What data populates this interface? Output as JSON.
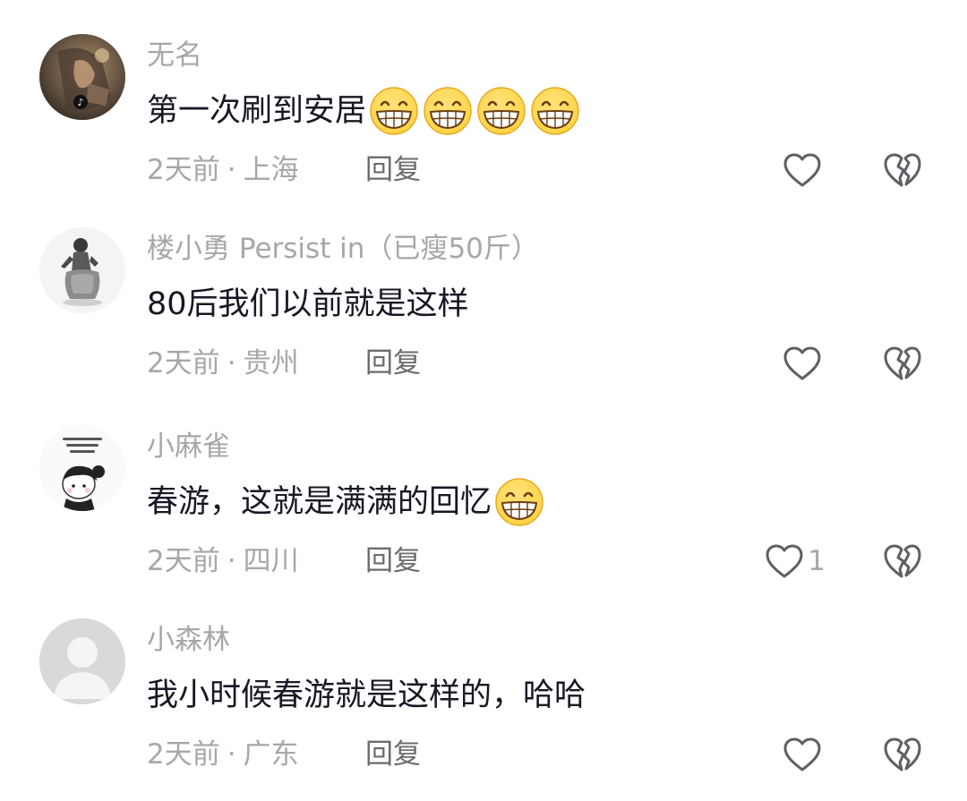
{
  "comments": [
    {
      "username": "无名",
      "text": "第一次刷到安居",
      "emoji_count": 4,
      "emoji": "grinning-face-emoji",
      "time": "2天前",
      "location": "上海",
      "reply_label": "回复",
      "like_count": "",
      "avatar": "photo-avatar"
    },
    {
      "username": "楼小勇 Persist in（已瘦50斤）",
      "text": "80后我们以前就是这样",
      "emoji_count": 0,
      "time": "2天前",
      "location": "贵州",
      "reply_label": "回复",
      "like_count": "",
      "avatar": "figure-avatar"
    },
    {
      "username": "小麻雀",
      "text": "春游，这就是满满的回忆",
      "emoji_count": 1,
      "emoji": "grinning-face-emoji",
      "time": "2天前",
      "location": "四川",
      "reply_label": "回复",
      "like_count": "1",
      "avatar": "cartoon-girl-avatar"
    },
    {
      "username": "小森林",
      "text": "我小时候春游就是这样的，哈哈",
      "emoji_count": 0,
      "time": "2天前",
      "location": "广东",
      "reply_label": "回复",
      "like_count": "",
      "avatar": "default-user-avatar"
    }
  ],
  "meta_separator": "·",
  "colors": {
    "text": "#161823",
    "secondary": "#a7a7ab",
    "reply": "#6b6b70",
    "icon": "#5f5f64",
    "emoji_yellow": "#ffd23f"
  }
}
